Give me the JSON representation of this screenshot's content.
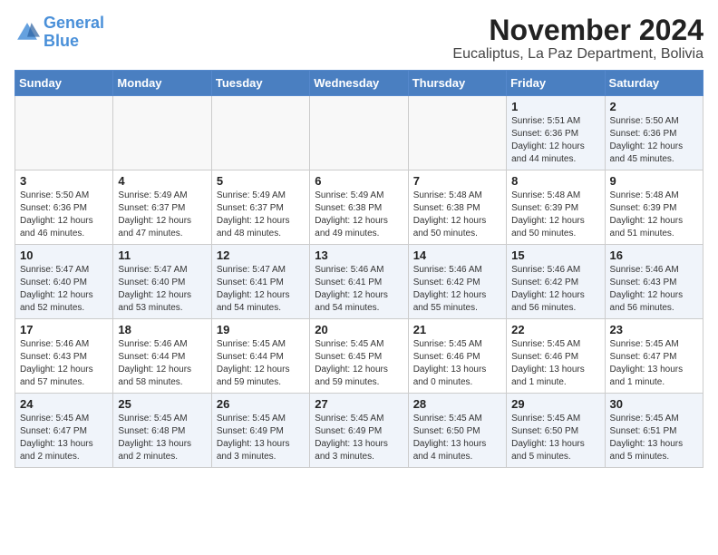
{
  "header": {
    "logo_line1": "General",
    "logo_line2": "Blue",
    "month": "November 2024",
    "location": "Eucaliptus, La Paz Department, Bolivia"
  },
  "weekdays": [
    "Sunday",
    "Monday",
    "Tuesday",
    "Wednesday",
    "Thursday",
    "Friday",
    "Saturday"
  ],
  "weeks": [
    [
      {
        "day": "",
        "info": ""
      },
      {
        "day": "",
        "info": ""
      },
      {
        "day": "",
        "info": ""
      },
      {
        "day": "",
        "info": ""
      },
      {
        "day": "",
        "info": ""
      },
      {
        "day": "1",
        "info": "Sunrise: 5:51 AM\nSunset: 6:36 PM\nDaylight: 12 hours\nand 44 minutes."
      },
      {
        "day": "2",
        "info": "Sunrise: 5:50 AM\nSunset: 6:36 PM\nDaylight: 12 hours\nand 45 minutes."
      }
    ],
    [
      {
        "day": "3",
        "info": "Sunrise: 5:50 AM\nSunset: 6:36 PM\nDaylight: 12 hours\nand 46 minutes."
      },
      {
        "day": "4",
        "info": "Sunrise: 5:49 AM\nSunset: 6:37 PM\nDaylight: 12 hours\nand 47 minutes."
      },
      {
        "day": "5",
        "info": "Sunrise: 5:49 AM\nSunset: 6:37 PM\nDaylight: 12 hours\nand 48 minutes."
      },
      {
        "day": "6",
        "info": "Sunrise: 5:49 AM\nSunset: 6:38 PM\nDaylight: 12 hours\nand 49 minutes."
      },
      {
        "day": "7",
        "info": "Sunrise: 5:48 AM\nSunset: 6:38 PM\nDaylight: 12 hours\nand 50 minutes."
      },
      {
        "day": "8",
        "info": "Sunrise: 5:48 AM\nSunset: 6:39 PM\nDaylight: 12 hours\nand 50 minutes."
      },
      {
        "day": "9",
        "info": "Sunrise: 5:48 AM\nSunset: 6:39 PM\nDaylight: 12 hours\nand 51 minutes."
      }
    ],
    [
      {
        "day": "10",
        "info": "Sunrise: 5:47 AM\nSunset: 6:40 PM\nDaylight: 12 hours\nand 52 minutes."
      },
      {
        "day": "11",
        "info": "Sunrise: 5:47 AM\nSunset: 6:40 PM\nDaylight: 12 hours\nand 53 minutes."
      },
      {
        "day": "12",
        "info": "Sunrise: 5:47 AM\nSunset: 6:41 PM\nDaylight: 12 hours\nand 54 minutes."
      },
      {
        "day": "13",
        "info": "Sunrise: 5:46 AM\nSunset: 6:41 PM\nDaylight: 12 hours\nand 54 minutes."
      },
      {
        "day": "14",
        "info": "Sunrise: 5:46 AM\nSunset: 6:42 PM\nDaylight: 12 hours\nand 55 minutes."
      },
      {
        "day": "15",
        "info": "Sunrise: 5:46 AM\nSunset: 6:42 PM\nDaylight: 12 hours\nand 56 minutes."
      },
      {
        "day": "16",
        "info": "Sunrise: 5:46 AM\nSunset: 6:43 PM\nDaylight: 12 hours\nand 56 minutes."
      }
    ],
    [
      {
        "day": "17",
        "info": "Sunrise: 5:46 AM\nSunset: 6:43 PM\nDaylight: 12 hours\nand 57 minutes."
      },
      {
        "day": "18",
        "info": "Sunrise: 5:46 AM\nSunset: 6:44 PM\nDaylight: 12 hours\nand 58 minutes."
      },
      {
        "day": "19",
        "info": "Sunrise: 5:45 AM\nSunset: 6:44 PM\nDaylight: 12 hours\nand 59 minutes."
      },
      {
        "day": "20",
        "info": "Sunrise: 5:45 AM\nSunset: 6:45 PM\nDaylight: 12 hours\nand 59 minutes."
      },
      {
        "day": "21",
        "info": "Sunrise: 5:45 AM\nSunset: 6:46 PM\nDaylight: 13 hours\nand 0 minutes."
      },
      {
        "day": "22",
        "info": "Sunrise: 5:45 AM\nSunset: 6:46 PM\nDaylight: 13 hours\nand 1 minute."
      },
      {
        "day": "23",
        "info": "Sunrise: 5:45 AM\nSunset: 6:47 PM\nDaylight: 13 hours\nand 1 minute."
      }
    ],
    [
      {
        "day": "24",
        "info": "Sunrise: 5:45 AM\nSunset: 6:47 PM\nDaylight: 13 hours\nand 2 minutes."
      },
      {
        "day": "25",
        "info": "Sunrise: 5:45 AM\nSunset: 6:48 PM\nDaylight: 13 hours\nand 2 minutes."
      },
      {
        "day": "26",
        "info": "Sunrise: 5:45 AM\nSunset: 6:49 PM\nDaylight: 13 hours\nand 3 minutes."
      },
      {
        "day": "27",
        "info": "Sunrise: 5:45 AM\nSunset: 6:49 PM\nDaylight: 13 hours\nand 3 minutes."
      },
      {
        "day": "28",
        "info": "Sunrise: 5:45 AM\nSunset: 6:50 PM\nDaylight: 13 hours\nand 4 minutes."
      },
      {
        "day": "29",
        "info": "Sunrise: 5:45 AM\nSunset: 6:50 PM\nDaylight: 13 hours\nand 5 minutes."
      },
      {
        "day": "30",
        "info": "Sunrise: 5:45 AM\nSunset: 6:51 PM\nDaylight: 13 hours\nand 5 minutes."
      }
    ]
  ]
}
